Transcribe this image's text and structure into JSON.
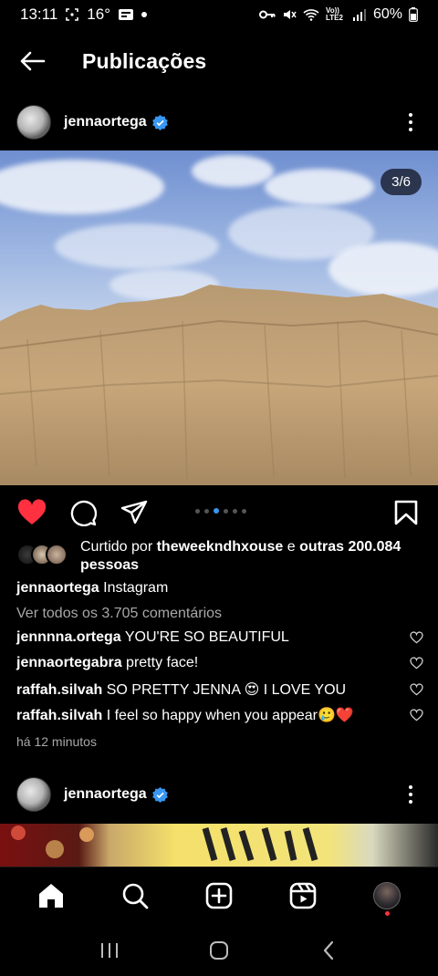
{
  "status_bar": {
    "time": "13:11",
    "temp": "16°",
    "network": "Vo)) LTE2",
    "battery": "60%"
  },
  "header": {
    "title": "Publicações"
  },
  "post": {
    "username": "jennaortega",
    "image_counter": "3/6",
    "carousel": {
      "count": 6,
      "active_index": 3
    },
    "likes": {
      "prefix": "Curtido por ",
      "user": "theweekndhxouse",
      "middle": " e ",
      "others": "outras 200.084 pessoas"
    },
    "caption": {
      "username": "jennaortega",
      "text": "Instagram"
    },
    "view_comments": "Ver todos os 3.705 comentários",
    "comments": [
      {
        "username": "jennnna.ortega",
        "text": "YOU'RE SO BEAUTIFUL"
      },
      {
        "username": "jennaortegabra",
        "text": "pretty face!"
      },
      {
        "username": "raffah.silvah",
        "text": "SO PRETTY JENNA 😍 I LOVE YOU"
      },
      {
        "username": "raffah.silvah",
        "text": "I feel so happy when you appear🥲❤️"
      }
    ],
    "timestamp": "há 12 minutos"
  },
  "next_post": {
    "username": "jennaortega"
  },
  "colors": {
    "background": "#000000",
    "like_red": "#ff3040",
    "verified_blue": "#3897f0",
    "muted_text": "#a8a8a8"
  },
  "icons": {
    "back": "arrow-left-icon",
    "more": "more-vertical-icon",
    "like": "heart-filled-icon",
    "comment": "comment-bubble-icon",
    "share": "paper-plane-icon",
    "save": "bookmark-icon",
    "nav": [
      "home-icon",
      "search-icon",
      "add-icon",
      "reels-icon",
      "profile-avatar"
    ]
  }
}
